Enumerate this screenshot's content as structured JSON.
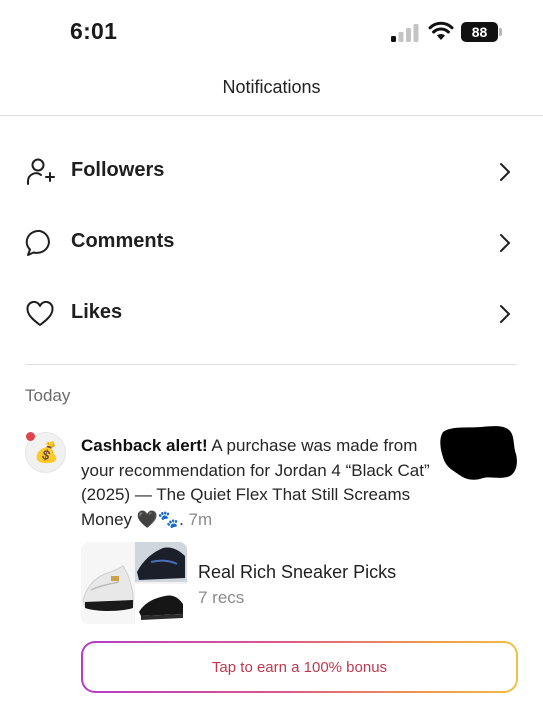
{
  "status_bar": {
    "time": "6:01",
    "battery": "88",
    "signal_icon": "cellular-signal-icon",
    "wifi_icon": "wifi-icon"
  },
  "header": {
    "title": "Notifications"
  },
  "menu": [
    {
      "label": "Followers",
      "icon": "add-person-icon"
    },
    {
      "label": "Comments",
      "icon": "speech-bubble-icon"
    },
    {
      "label": "Likes",
      "icon": "heart-icon"
    }
  ],
  "today": {
    "heading": "Today",
    "notification": {
      "avatar_emoji": "💰",
      "title": "Cashback alert!",
      "message": " A purchase was made from your recommendation for Jordan 4 “Black Cat” (2025) — The Quiet Flex That Still Screams Money 🖤🐾. ",
      "time": "7m",
      "unread": true,
      "collection": {
        "name": "Real Rich Sneaker Picks",
        "count": "7 recs"
      }
    }
  },
  "bonus_button": {
    "label": "Tap to earn a 100% bonus"
  },
  "colors": {
    "unread_dot": "#e0434e",
    "bonus_text": "#c0394d",
    "divider": "#dedede"
  }
}
